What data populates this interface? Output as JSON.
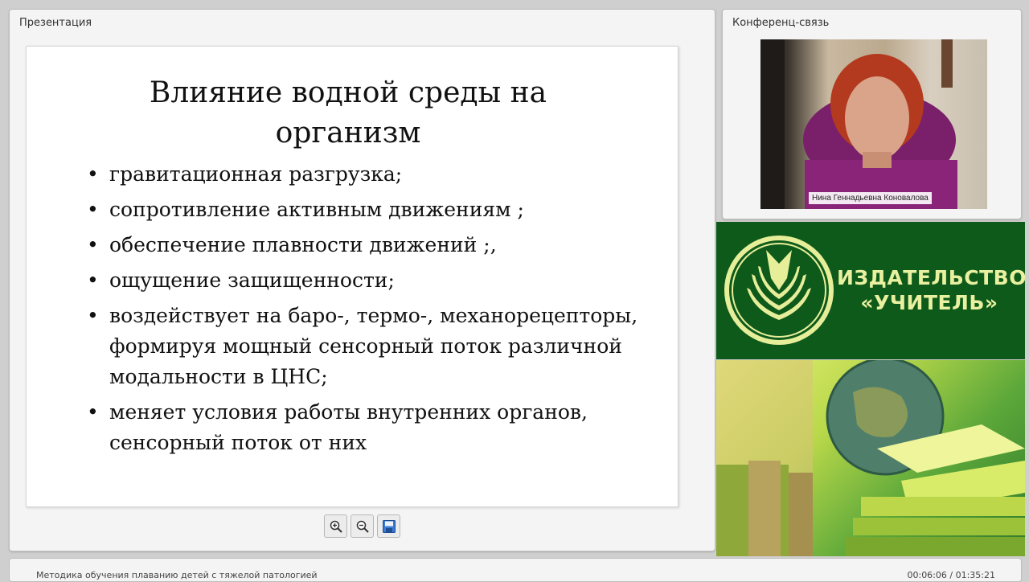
{
  "presentation": {
    "panel_title": "Презентация",
    "slide": {
      "title": "Влияние водной среды на\nорганизм",
      "bullets": [
        "гравитационная разгрузка;",
        "сопротивление активным движениям ;",
        "обеспечение плавности движений ;,",
        "ощущение защищенности;",
        "воздействует на баро-, термо-, механорецепторы, формируя мощный сенсорный поток различной модальности в ЦНС;",
        "меняет условия работы внутренних органов, сенсорный поток от них"
      ]
    },
    "toolbar": {
      "zoom_in_icon": "zoom-in-icon",
      "zoom_out_icon": "zoom-out-icon",
      "save_icon": "save-icon"
    }
  },
  "conference": {
    "panel_title": "Конференц-связь",
    "participant_name": "Нина Геннадьевна Коновалова"
  },
  "publisher": {
    "logo_text_line1": "ИЗДАТЕЛЬСТВО",
    "logo_text_line2": "«УЧИТЕЛЬ»",
    "brand_green": "#0e5a1a",
    "brand_text_color": "#e9f0a0"
  },
  "footer": {
    "course_title": "Методика обучения плаванию детей с тяжелой патологией",
    "timecode": "00:06:06 / 01:35:21"
  }
}
